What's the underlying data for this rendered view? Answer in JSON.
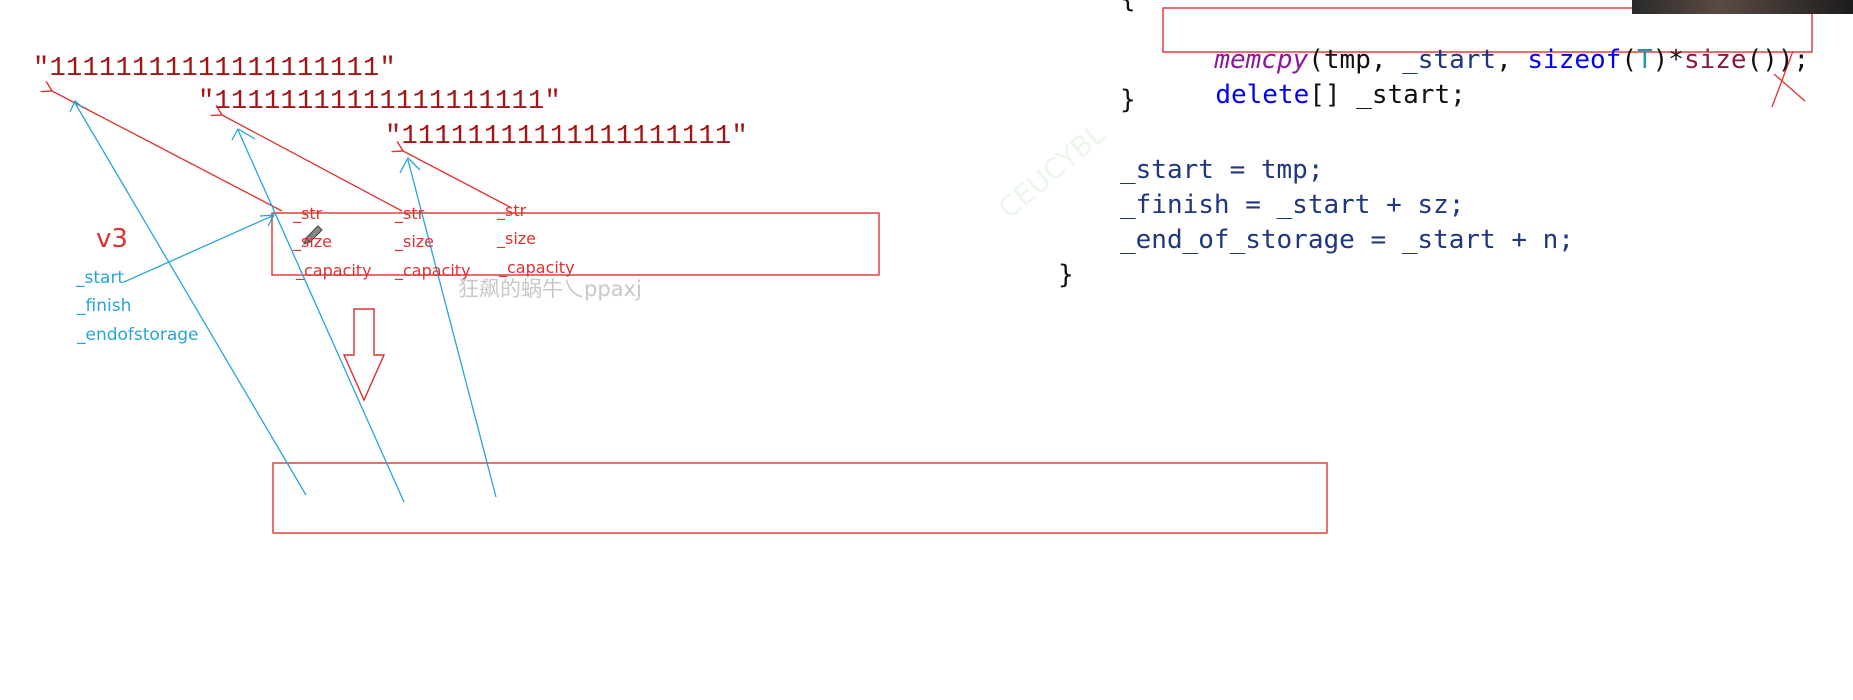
{
  "diagram": {
    "string_literals": [
      "\"11111111111111111111\"",
      "\"11111111111111111111\"",
      "\"11111111111111111111\""
    ],
    "string_fields": {
      "str": "_str",
      "size": "_size",
      "capacity": "_capacity"
    },
    "vector_name": "v3",
    "vector_fields": [
      "_start",
      "_finish",
      "_endofstorage"
    ],
    "watermark": "狂飙的蜗牛乀ppaxj",
    "faint_watermark": "CEUCYBL"
  },
  "code": {
    "line0": "{",
    "line1": {
      "fn": "memcpy",
      "a1": "(tmp, ",
      "a2": "_start",
      "a3": ", ",
      "kw": "sizeof",
      "a4": "(",
      "tp": "T",
      "a5": ")*",
      "fn2": "size",
      "a6": "());"
    },
    "line2": {
      "kw": "delete",
      "rest": "[] _start;"
    },
    "line3": "}",
    "line4": "_start = tmp;",
    "line5": "_finish = _start + sz;",
    "line6": "_end_of_storage = _start + n;",
    "line7": "}"
  },
  "colors": {
    "red": "#e03030",
    "blue": "#26a6d6",
    "string": "#a31515"
  }
}
